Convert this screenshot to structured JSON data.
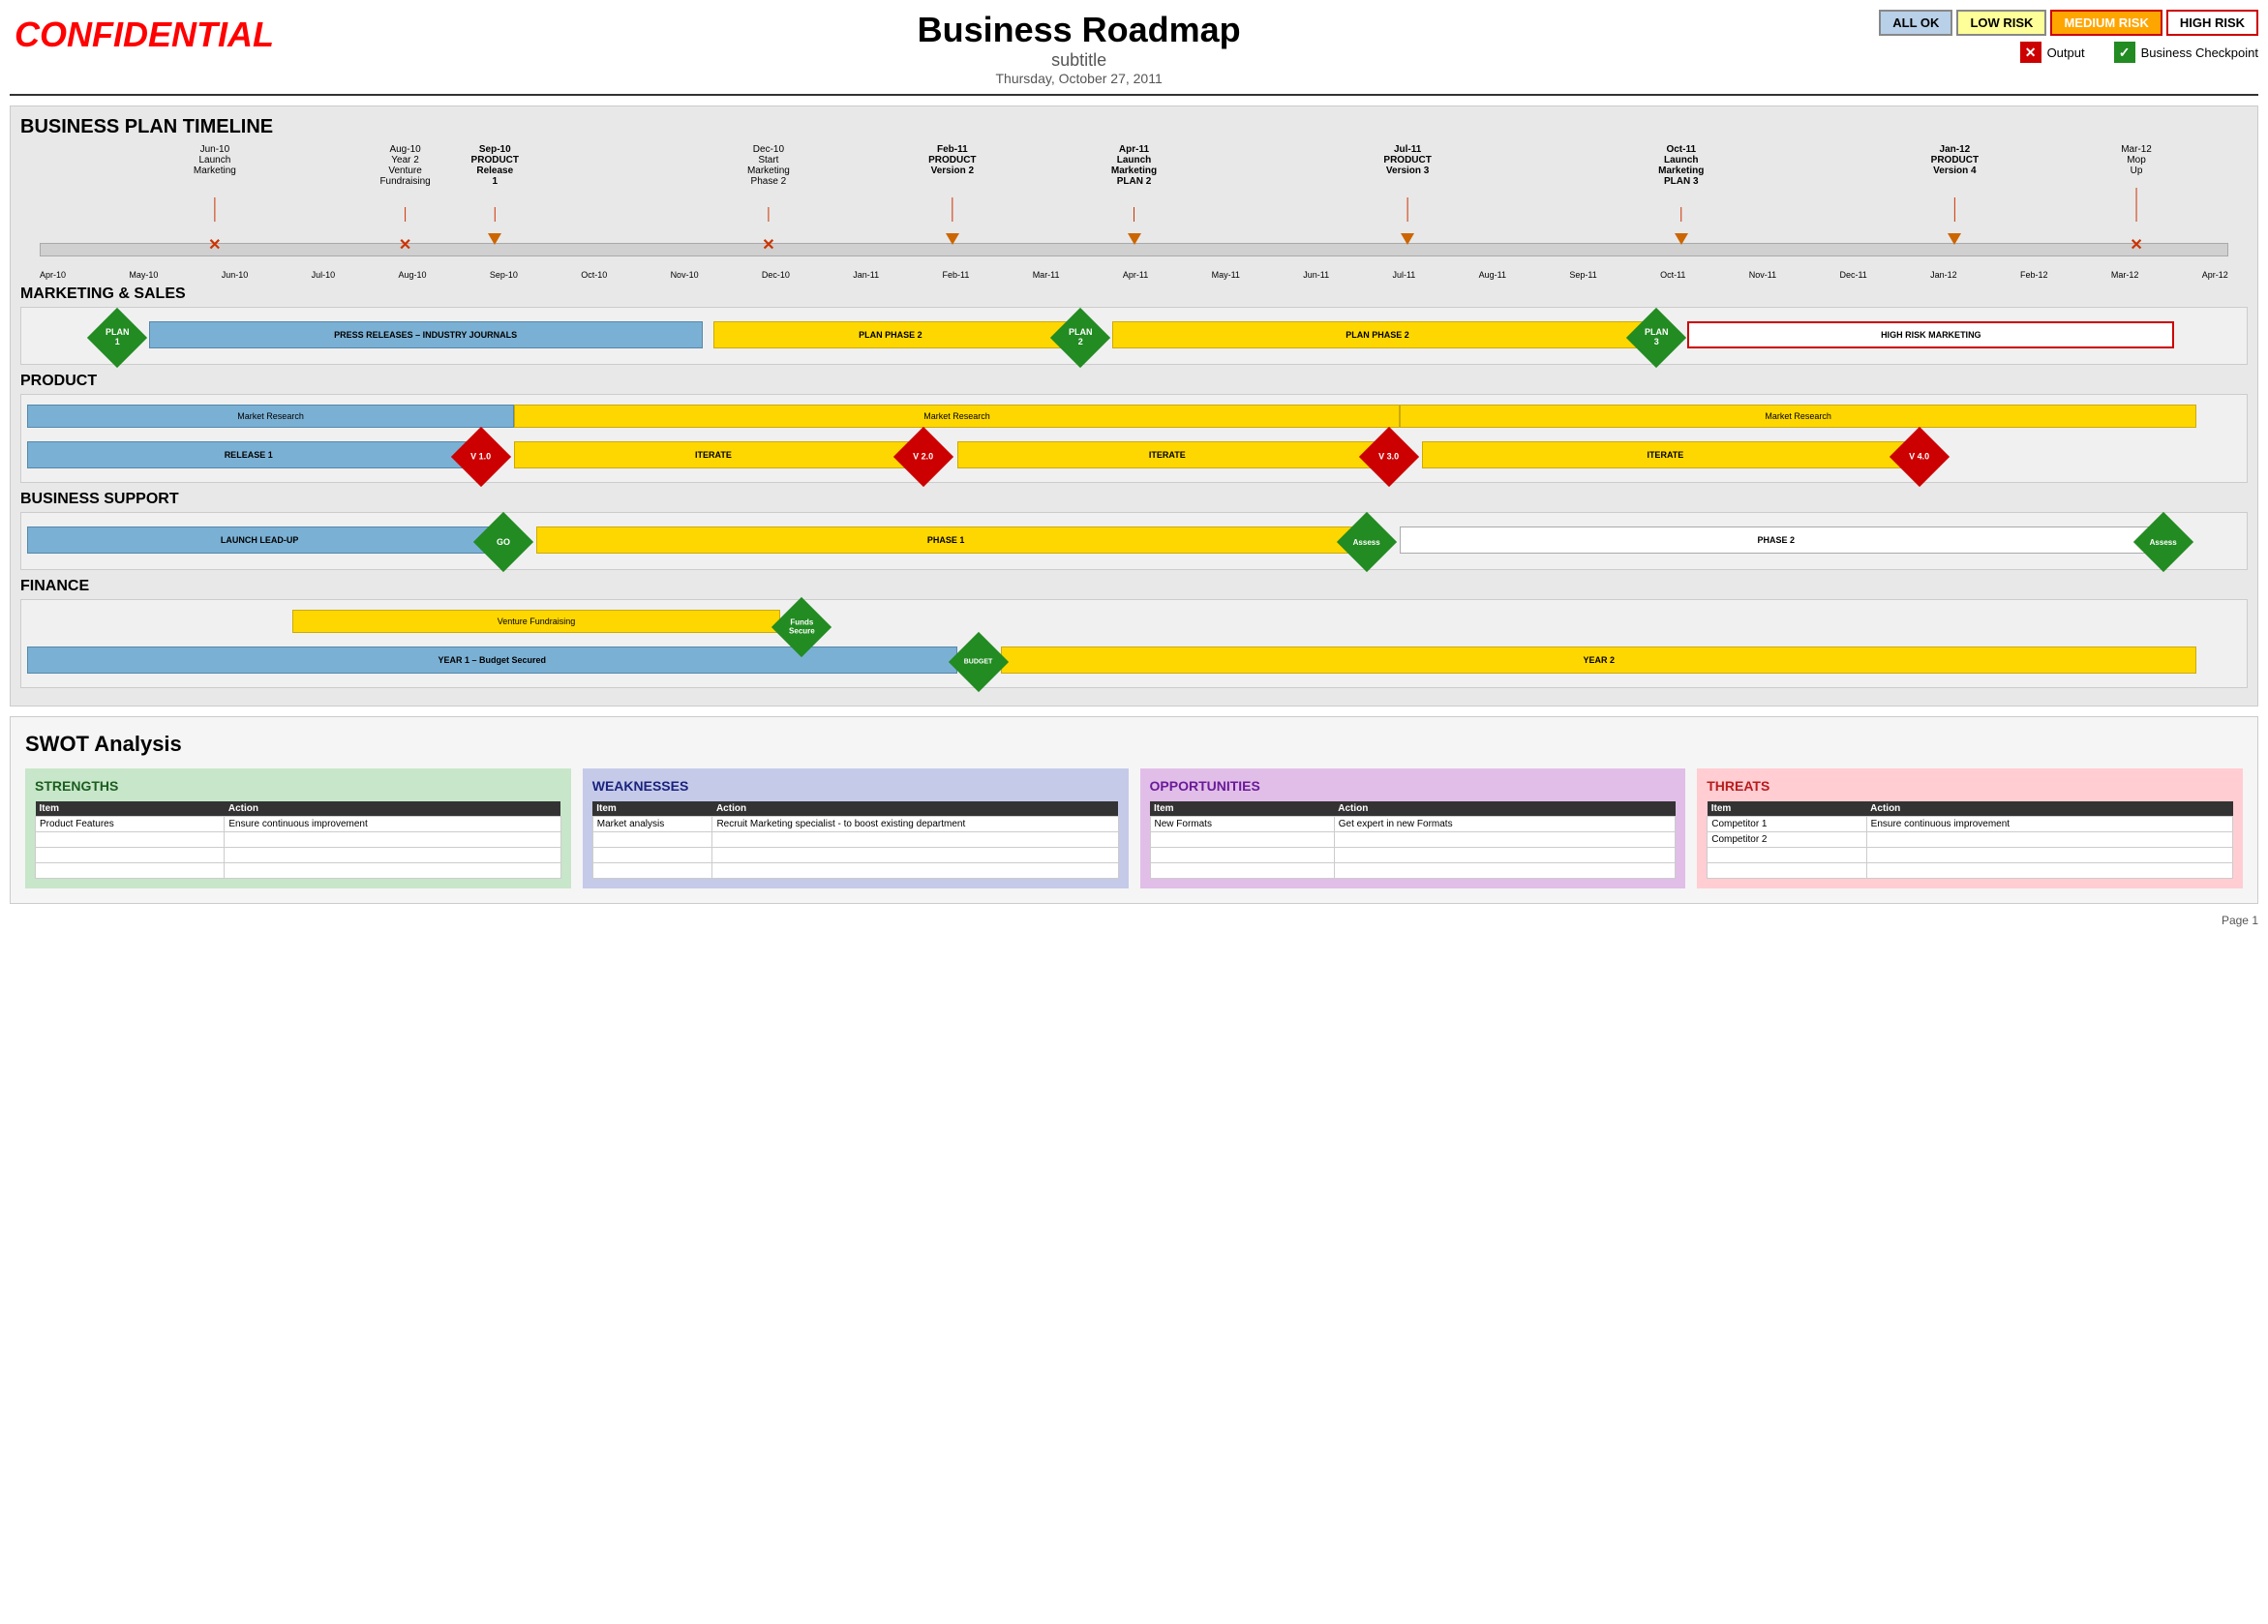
{
  "header": {
    "confidential": "CONFIDENTIAL",
    "title": "Business Roadmap",
    "subtitle": "subtitle",
    "date": "Thursday, October 27, 2011",
    "risk_buttons": {
      "all_ok": "ALL OK",
      "low_risk": "LOW RISK",
      "medium_risk": "MEDIUM RISK",
      "high_risk": "HIGH RISK"
    },
    "legend": {
      "output_label": "Output",
      "checkpoint_label": "Business Checkpoint"
    }
  },
  "timeline": {
    "section_title": "BUSINESS PLAN TIMELINE",
    "milestones": [
      {
        "label": "Jun-10\nLaunch\nMarketing",
        "pos_pct": 8.3,
        "bold": false
      },
      {
        "label": "Aug-10\nYear 2\nVenture\nFundraising",
        "pos_pct": 16.7,
        "bold": false
      },
      {
        "label": "Sep-10\nPRODUCT\nRelease\n1",
        "pos_pct": 20.8,
        "bold": true
      },
      {
        "label": "Dec-10\nStart\nMarketing\nPhase 2",
        "pos_pct": 33.3,
        "bold": false
      },
      {
        "label": "Feb-11\nPRODUCT\nVersion 2",
        "pos_pct": 41.7,
        "bold": true
      },
      {
        "label": "Apr-11\nLaunch\nMarketing\nPLAN 2",
        "pos_pct": 50.0,
        "bold": true
      },
      {
        "label": "Jul-11\nPRODUCT\nVersion 3",
        "pos_pct": 62.5,
        "bold": true
      },
      {
        "label": "Oct-11\nLaunch\nMarketing\nPLAN 3",
        "pos_pct": 75.0,
        "bold": true
      },
      {
        "label": "Jan-12\nPRODUCT\nVersion 4",
        "pos_pct": 87.5,
        "bold": true
      },
      {
        "label": "Mar-12\nMop\nUp",
        "pos_pct": 95.8,
        "bold": false
      }
    ],
    "months": [
      "Apr-10",
      "May-10",
      "Jun-10",
      "Jul-10",
      "Aug-10",
      "Sep-10",
      "Oct-10",
      "Nov-10",
      "Dec-10",
      "Jan-11",
      "Feb-11",
      "Mar-11",
      "Apr-11",
      "May-11",
      "Jun-11",
      "Jul-11",
      "Aug-11",
      "Sep-11",
      "Oct-11",
      "Nov-11",
      "Dec-11",
      "Jan-12",
      "Feb-12",
      "Mar-12",
      "Apr-12"
    ]
  },
  "marketing_sales": {
    "section_title": "MARKETING & SALES",
    "plan1_label": "PLAN\n1",
    "plan2_label": "PLAN\n2",
    "plan3_label": "PLAN\n3",
    "bar1_label": "PRESS RELEASES – INDUSTRY JOURNALS",
    "bar2_label": "PLAN PHASE 2",
    "bar3_label": "PLAN PHASE 2",
    "bar4_label": "HIGH RISK MARKETING"
  },
  "product": {
    "section_title": "PRODUCT",
    "market_research1": "Market Research",
    "market_research2": "Market Research",
    "market_research3": "Market Research",
    "release1": "RELEASE 1",
    "v1": "V 1.0",
    "iterate1": "ITERATE",
    "v2": "V 2.0",
    "iterate2": "ITERATE",
    "v3": "V 3.0",
    "iterate3": "ITERATE",
    "v4": "V 4.0"
  },
  "business_support": {
    "section_title": "BUSINESS SUPPORT",
    "launch": "LAUNCH LEAD-UP",
    "go": "GO",
    "phase1": "PHASE 1",
    "assess1": "Assess",
    "phase2": "PHASE 2",
    "assess2": "Assess"
  },
  "finance": {
    "section_title": "FINANCE",
    "venture": "Venture Fundraising",
    "funds_secure": "Funds\nSecure",
    "year1": "YEAR 1 – Budget Secured",
    "budget": "BUDGET",
    "year2": "YEAR 2"
  },
  "swot": {
    "title": "SWOT Analysis",
    "strengths": {
      "title": "STRENGTHS",
      "headers": [
        "Item",
        "Action"
      ],
      "rows": [
        [
          "Product Features",
          "Ensure continuous improvement"
        ],
        [
          "",
          ""
        ],
        [
          "",
          ""
        ],
        [
          "",
          ""
        ]
      ]
    },
    "weaknesses": {
      "title": "WEAKNESSES",
      "headers": [
        "Item",
        "Action"
      ],
      "rows": [
        [
          "Market analysis",
          "Recruit Marketing specialist - to boost existing department"
        ],
        [
          "",
          ""
        ],
        [
          "",
          ""
        ],
        [
          "",
          ""
        ]
      ]
    },
    "opportunities": {
      "title": "OPPORTUNITIES",
      "headers": [
        "Item",
        "Action"
      ],
      "rows": [
        [
          "New Formats",
          "Get expert in new Formats"
        ],
        [
          "",
          ""
        ],
        [
          "",
          ""
        ],
        [
          "",
          ""
        ]
      ]
    },
    "threats": {
      "title": "THREATS",
      "headers": [
        "Item",
        "Action"
      ],
      "rows": [
        [
          "Competitor 1",
          "Ensure continuous improvement"
        ],
        [
          "Competitor 2",
          ""
        ],
        [
          "",
          ""
        ],
        [
          "",
          ""
        ]
      ]
    }
  },
  "page_number": "Page 1"
}
